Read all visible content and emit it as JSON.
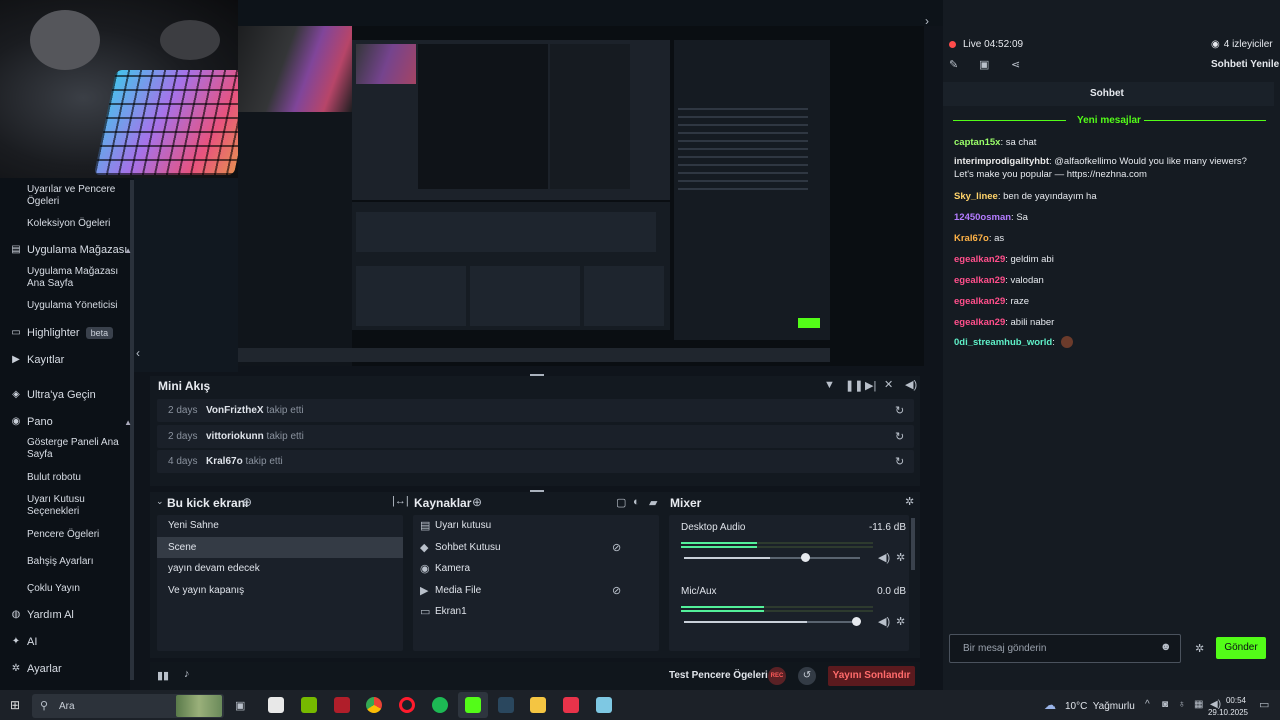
{
  "sidebar": {
    "items": [
      {
        "label": "Uyarılar ve Pencere Ögeleri",
        "type": "sub"
      },
      {
        "label": "Koleksiyon Ögeleri",
        "type": "sub"
      },
      {
        "label": "Uygulama Mağazası",
        "type": "main",
        "icon": "store-icon"
      },
      {
        "label": "Uygulama Mağazası Ana Sayfa",
        "type": "sub"
      },
      {
        "label": "Uygulama Yöneticisi",
        "type": "sub"
      },
      {
        "label": "Highlighter",
        "type": "main",
        "icon": "highlighter-icon",
        "badge": "beta"
      },
      {
        "label": "Kayıtlar",
        "type": "main",
        "icon": "play-icon"
      },
      {
        "label": "Ultra'ya Geçin",
        "type": "main",
        "icon": "ultra-icon"
      },
      {
        "label": "Pano",
        "type": "main",
        "icon": "dashboard-icon"
      },
      {
        "label": "Gösterge Paneli Ana Sayfa",
        "type": "sub"
      },
      {
        "label": "Bulut robotu",
        "type": "sub"
      },
      {
        "label": "Uyarı Kutusu Seçenekleri",
        "type": "sub"
      },
      {
        "label": "Pencere Ögeleri",
        "type": "sub"
      },
      {
        "label": "Bahşiş Ayarları",
        "type": "sub"
      },
      {
        "label": "Çoklu Yayın",
        "type": "sub"
      },
      {
        "label": "Yardım Al",
        "type": "main",
        "icon": "help-icon"
      },
      {
        "label": "AI",
        "type": "main",
        "icon": "ai-icon"
      },
      {
        "label": "Ayarlar",
        "type": "main",
        "icon": "gear-icon"
      }
    ]
  },
  "mini_feed": {
    "title": "Mini Akış",
    "rows": [
      {
        "time": "2 days",
        "user": "VonFriztheX",
        "action": "takip etti"
      },
      {
        "time": "2 days",
        "user": "vittoriokunn",
        "action": "takip etti"
      },
      {
        "time": "4 days",
        "user": "Kral67o",
        "action": "takip etti"
      }
    ]
  },
  "scenes": {
    "title": "Bu kick ekranı",
    "items": [
      "Yeni Sahne",
      "Scene",
      "yayın devam edecek",
      "Ve yayın kapanış"
    ],
    "selected": "Scene"
  },
  "sources": {
    "title": "Kaynaklar",
    "items": [
      {
        "label": "Uyarı kutusu",
        "icon": "alert-box-icon"
      },
      {
        "label": "Sohbet Kutusu",
        "icon": "chat-box-icon"
      },
      {
        "label": "Kamera",
        "icon": "camera-icon"
      },
      {
        "label": "Media File",
        "icon": "media-icon"
      },
      {
        "label": "Ekran1",
        "icon": "monitor-icon"
      }
    ]
  },
  "mixer": {
    "title": "Mixer",
    "channels": [
      {
        "name": "Desktop Audio",
        "db": "-11.6 dB",
        "level": 0.55,
        "volume": 0.7
      },
      {
        "name": "Mic/Aux",
        "db": "0.0 dB",
        "level": 0.6,
        "volume": 1.0
      }
    ]
  },
  "footer": {
    "test_label": "Test Pencere Ögeleri",
    "rec_label": "REC",
    "end_stream": "Yayını Sonlandır"
  },
  "chat": {
    "live_label": "Live",
    "live_time": "04:52:09",
    "viewers": "4 izleyiciler",
    "refresh": "Sohbeti Yenile",
    "title": "Sohbet",
    "new_messages": "Yeni mesajlar",
    "messages": [
      {
        "user": "captan15x",
        "text": "sa chat",
        "color": "#9bff6a"
      },
      {
        "user": "interimprodigalityhbt",
        "text": "@alfaofkellimo Would you like many viewers? Let's make you popular — https://nezhna.com",
        "color": "#e8e8e8"
      },
      {
        "user": "Sky_linee",
        "text": "ben de yayındayım ha",
        "color": "#ffd36a"
      },
      {
        "user": "12450osman",
        "text": "Sa",
        "color": "#b47cff"
      },
      {
        "user": "Kral67o",
        "text": "as",
        "color": "#ffb347"
      },
      {
        "user": "egealkan29",
        "text": "geldim abi",
        "color": "#ff4f8b"
      },
      {
        "user": "egealkan29",
        "text": "valodan",
        "color": "#ff4f8b"
      },
      {
        "user": "egealkan29",
        "text": "raze",
        "color": "#ff4f8b"
      },
      {
        "user": "egealkan29",
        "text": "abili naber",
        "color": "#ff4f8b"
      },
      {
        "user": "0di_streamhub_world",
        "text": "",
        "color": "#5ff0c8"
      }
    ],
    "input_placeholder": "Bir mesaj gönderin",
    "send": "Gönder"
  },
  "taskbar": {
    "search_placeholder": "Ara",
    "weather": "10°C  Yağmurlu",
    "time": "00:54",
    "date": "29.10.2025"
  },
  "colors": {
    "accent_green": "#53fc18",
    "end_red": "#5b1a1e",
    "panel": "#1a2029"
  }
}
